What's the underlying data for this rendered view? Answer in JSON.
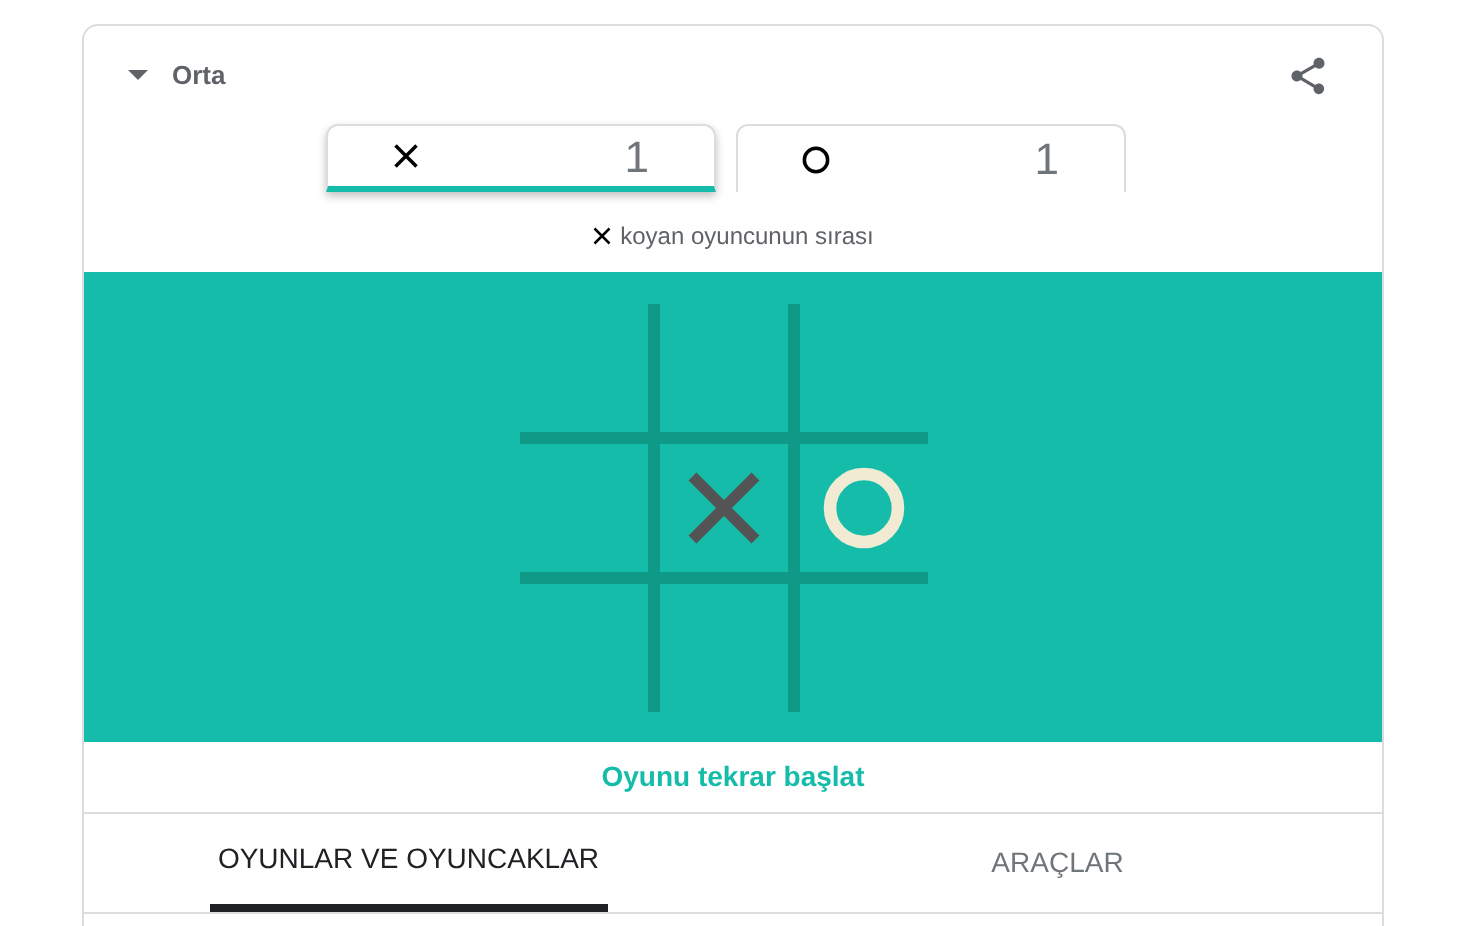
{
  "header": {
    "title": "Orta"
  },
  "scores": [
    {
      "kind": "x",
      "score": "1",
      "selected": true
    },
    {
      "kind": "o",
      "score": "1",
      "selected": false
    }
  ],
  "turn": {
    "kind": "x",
    "text": "koyan oyuncunun sırası"
  },
  "board": [
    {
      "cells": [
        {
          "kind": "empty"
        },
        {
          "kind": "empty"
        },
        {
          "kind": "empty"
        }
      ]
    },
    {
      "cells": [
        {
          "kind": "empty"
        },
        {
          "kind": "x"
        },
        {
          "kind": "o"
        }
      ]
    },
    {
      "cells": [
        {
          "kind": "empty"
        },
        {
          "kind": "empty"
        },
        {
          "kind": "empty"
        }
      ]
    }
  ],
  "restart": "Oyunu tekrar başlat",
  "tabs": [
    {
      "label": "OYUNLAR VE OYUNCAKLAR",
      "selected": true
    },
    {
      "label": "ARAÇLAR",
      "selected": false
    }
  ]
}
